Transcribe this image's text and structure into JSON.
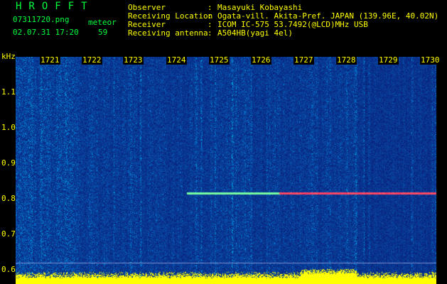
{
  "header": {
    "brand": "HROFFT",
    "filename": "07311720.png",
    "date_time": "02.07.31 17:20",
    "mode_label": "meteor",
    "count": "59",
    "fields": [
      {
        "label": "Observer",
        "value": "Masayuki Kobayashi"
      },
      {
        "label": "Receiving Location",
        "value": "Ogata-vill. Akita-Pref. JAPAN (139.96E, 40.02N)"
      },
      {
        "label": "Receiver",
        "value": "ICOM IC-575 53.7492(@LCD)MHz USB"
      },
      {
        "label": "Receiving antenna",
        "value": "A504HB(yagi 4el)"
      }
    ]
  },
  "spectrogram": {
    "y_unit": "kHz",
    "y_ticks": [
      "1.1",
      "1.0",
      "0.9",
      "0.8",
      "0.7",
      "0.6"
    ],
    "time_ticks": [
      "1721",
      "1722",
      "1723",
      "1724",
      "1725",
      "1726",
      "1727",
      "1728",
      "1729",
      "1730"
    ],
    "carrier_khz": 0.81,
    "colors": {
      "background": "#000000",
      "label_text": "#ffff00",
      "header_text": "#00ff3c",
      "noise_low": "#0a1a6e",
      "noise_high": "#00c8ff",
      "signal": "#ff2060",
      "baseline": "#ffff00"
    }
  }
}
